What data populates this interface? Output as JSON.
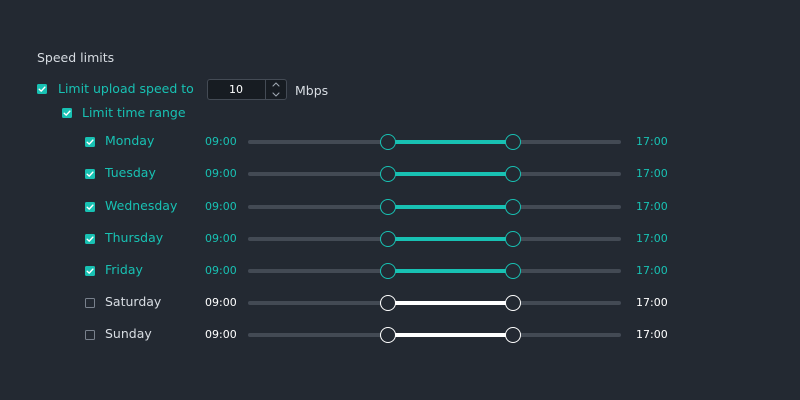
{
  "section_title": "Speed limits",
  "upload_limit": {
    "label": "Limit upload speed to",
    "checked": true,
    "value": "10",
    "unit": "Mbps"
  },
  "time_range": {
    "label": "Limit time range",
    "checked": true
  },
  "days": [
    {
      "label": "Monday",
      "checked": true,
      "start": "09:00",
      "end": "17:00"
    },
    {
      "label": "Tuesday",
      "checked": true,
      "start": "09:00",
      "end": "17:00"
    },
    {
      "label": "Wednesday",
      "checked": true,
      "start": "09:00",
      "end": "17:00"
    },
    {
      "label": "Thursday",
      "checked": true,
      "start": "09:00",
      "end": "17:00"
    },
    {
      "label": "Friday",
      "checked": true,
      "start": "09:00",
      "end": "17:00"
    },
    {
      "label": "Saturday",
      "checked": false,
      "start": "09:00",
      "end": "17:00"
    },
    {
      "label": "Sunday",
      "checked": false,
      "start": "09:00",
      "end": "17:00"
    }
  ],
  "icons": {
    "checkbox_checked": "checkmark-icon",
    "spin_up": "chevron-up-icon",
    "spin_down": "chevron-down-icon"
  },
  "colors": {
    "background": "#232932",
    "accent": "#18c1b3",
    "track": "#434a54",
    "text": "#d8dde3",
    "inactive_range": "#ffffff"
  }
}
